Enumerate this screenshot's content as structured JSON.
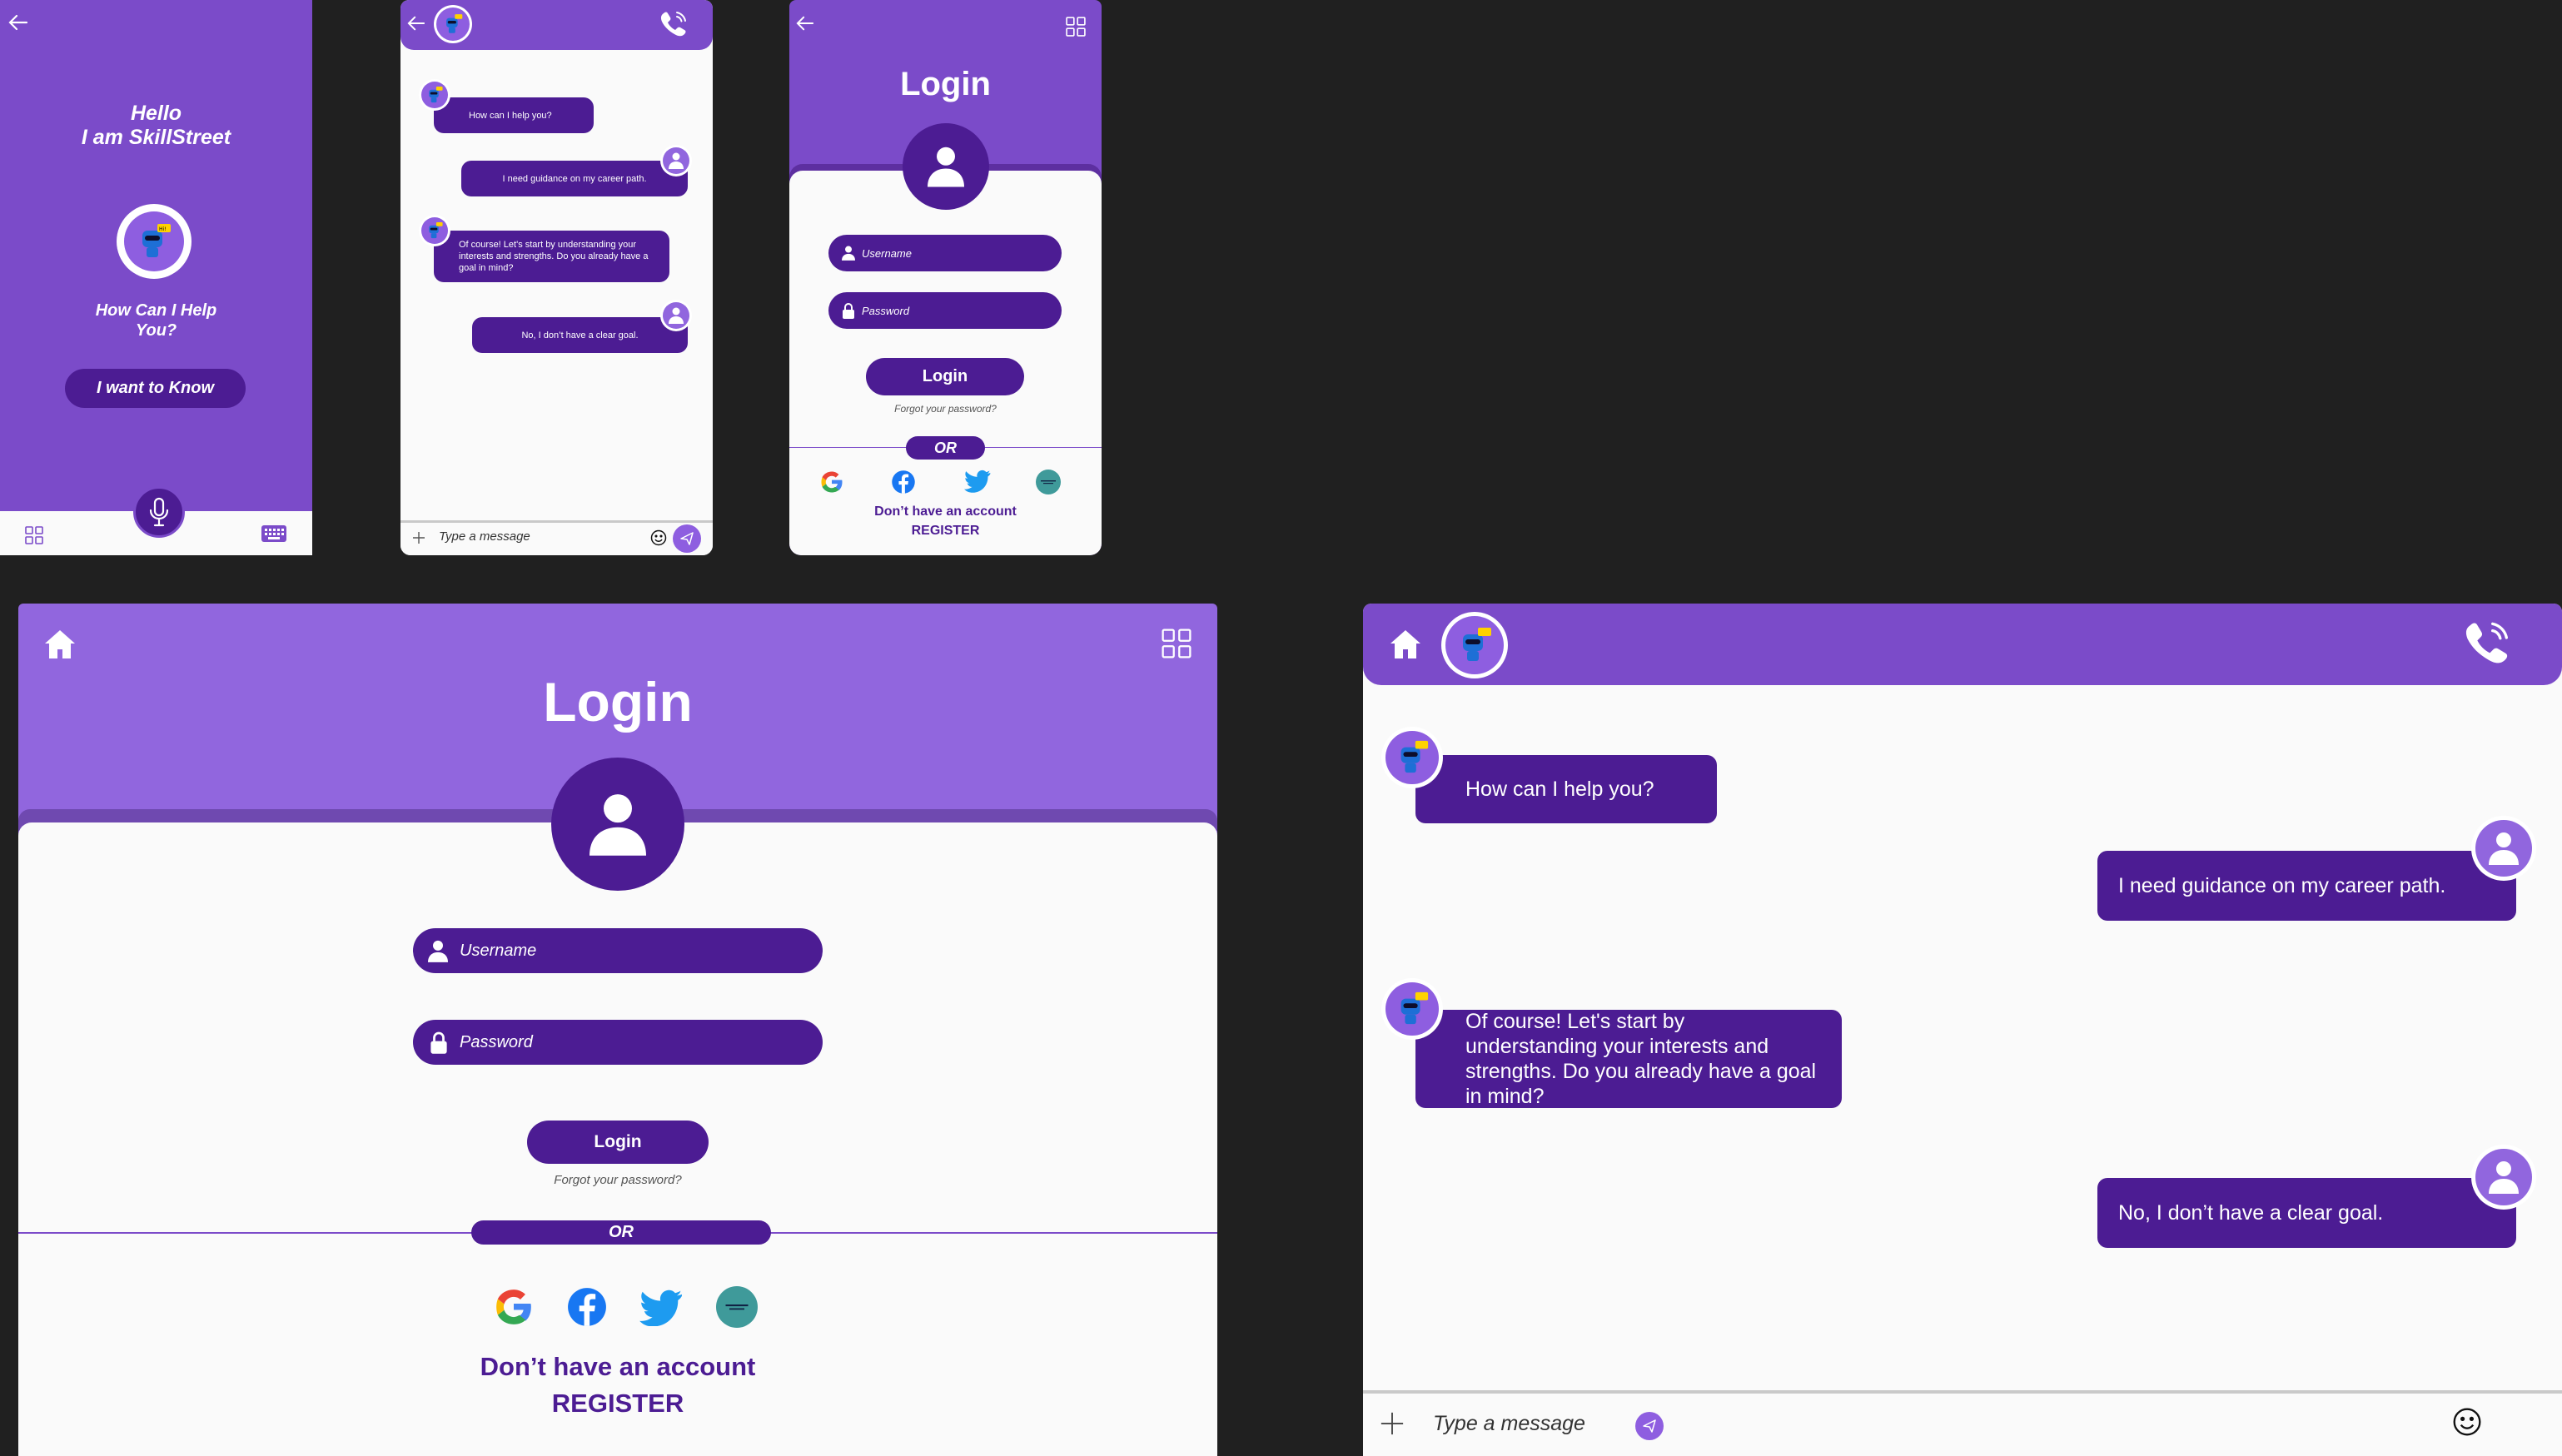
{
  "colors": {
    "canvas": "#202020",
    "primary": "#7b4bc9",
    "primary_light": "#9166de",
    "dark": "#4c1c93",
    "card": "#fafafa"
  },
  "welcome_screen": {
    "greeting_line1": "Hello",
    "greeting_line2": "I am SkillStreet",
    "help_line1": "How Can I Help",
    "help_line2": "You?",
    "know_button": "I want to Know",
    "icons": [
      "back-arrow-icon",
      "robot-icon",
      "microphone-icon",
      "grid-icon",
      "keyboard-icon"
    ]
  },
  "chat": {
    "messages": [
      {
        "from": "bot",
        "text": "How can I help you?"
      },
      {
        "from": "user",
        "text": "I need guidance on my career path."
      },
      {
        "from": "bot",
        "text": "Of course! Let's start by understanding your interests and strengths. Do you already have a goal in mind?"
      },
      {
        "from": "user",
        "text": "No, I don’t have a clear goal."
      }
    ],
    "input_placeholder": "Type a message",
    "icons": [
      "back-arrow-icon",
      "home-icon",
      "robot-icon",
      "phone-call-icon",
      "plus-icon",
      "emoji-icon",
      "send-icon"
    ]
  },
  "login": {
    "title": "Login",
    "username_placeholder": "Username",
    "password_placeholder": "Password",
    "login_button": "Login",
    "forgot_password": "Forgot your password?",
    "or_label": "OR",
    "no_account": "Don’t have an account",
    "register": "REGISTER",
    "social_providers": [
      "google-icon",
      "facebook-icon",
      "twitter-icon",
      "skillstreet-icon"
    ]
  }
}
